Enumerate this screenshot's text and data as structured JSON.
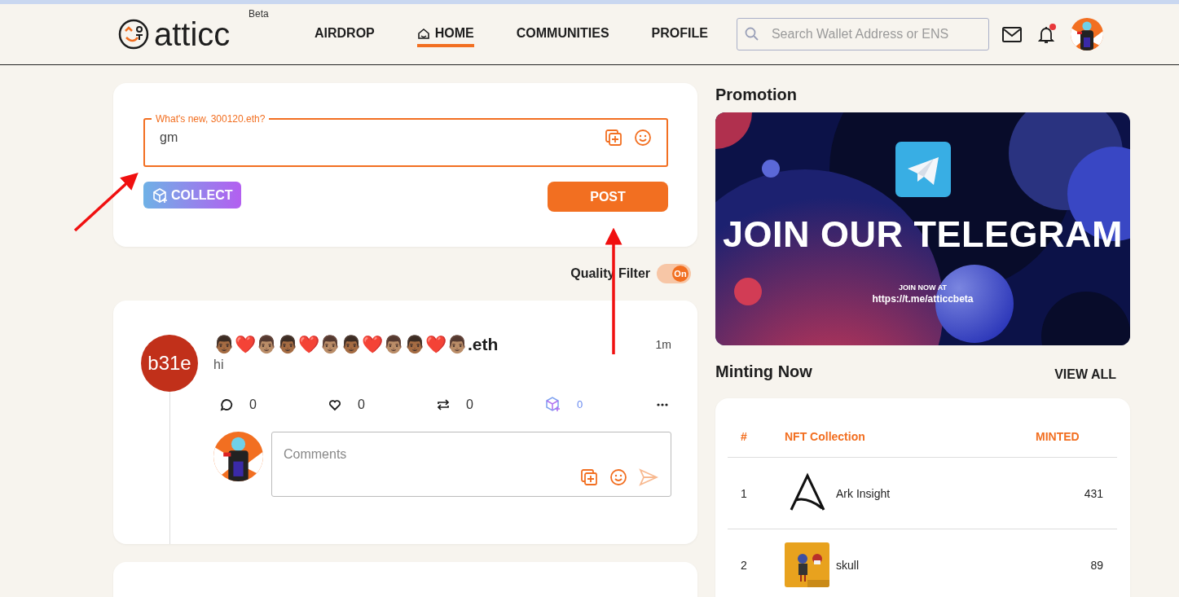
{
  "header": {
    "logo": {
      "text": "atticc",
      "badge": "Beta"
    },
    "nav": [
      {
        "label": "AIRDROP",
        "selected": false
      },
      {
        "label": "HOME",
        "selected": true
      },
      {
        "label": "COMMUNITIES",
        "selected": false
      },
      {
        "label": "PROFILE",
        "selected": false
      }
    ],
    "search": {
      "placeholder": "Search Wallet Address or ENS"
    },
    "notifications": {
      "unread": true
    }
  },
  "composer": {
    "label": "What's new, 300120.eth?",
    "value": "gm",
    "collect_button": "COLLECT",
    "post_button": "POST"
  },
  "quality_filter": {
    "label": "Quality Filter",
    "on": true,
    "state_text": "On"
  },
  "posts": [
    {
      "avatar_text": "b31e",
      "author": "👨🏾❤️👨🏽👨🏾❤️👨🏽👨🏾❤️👨🏽👨🏾❤️👨🏽.eth",
      "time": "1m",
      "text": "hi",
      "stats": [
        {
          "kind": "comment",
          "count": "0"
        },
        {
          "kind": "like",
          "count": "0"
        },
        {
          "kind": "repost",
          "count": "0"
        },
        {
          "kind": "collect",
          "count": "0"
        }
      ],
      "comment_placeholder": "Comments"
    }
  ],
  "promotion": {
    "title": "Promotion",
    "banner": {
      "headline": "JOIN OUR TELEGRAM",
      "caption": "JOIN NOW AT",
      "url": "https://t.me/atticcbeta"
    }
  },
  "minting": {
    "title": "Minting Now",
    "view_all": "VIEW ALL",
    "columns": [
      "#",
      "NFT Collection",
      "MINTED"
    ],
    "rows": [
      {
        "rank": "1",
        "name": "Ark Insight",
        "minted": "431",
        "kind": "logo"
      },
      {
        "rank": "2",
        "name": "skull",
        "minted": "89",
        "kind": "picture"
      }
    ]
  }
}
